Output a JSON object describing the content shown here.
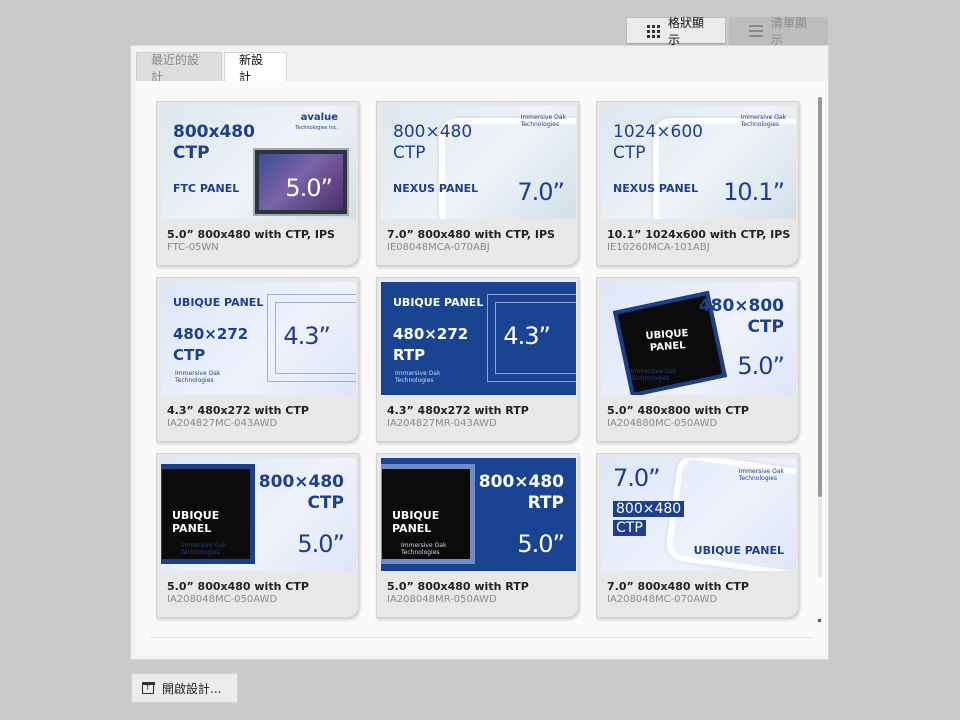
{
  "view_toggle": {
    "grid_label": "格狀顯示",
    "list_label": "清單顯示",
    "grid_icon": "grid-icon",
    "list_icon": "list-icon"
  },
  "tabs": [
    {
      "label": "最近的設計",
      "active": false
    },
    {
      "label": "新設計",
      "active": true
    }
  ],
  "cards": [
    {
      "title": "5.0” 800x480 with CTP, IPS",
      "code": "FTC-05WN",
      "thumb": {
        "res": "800x480\nCTP",
        "brand": "FTC PANEL",
        "size": "5.0”",
        "logo": "avalue",
        "logo_sub": "Technologies Inc."
      }
    },
    {
      "title": "7.0” 800x480 with CTP, IPS",
      "code": "IE08048MCA-070ABJ",
      "thumb": {
        "res": "800×480\nCTP",
        "brand": "NEXUS PANEL",
        "size": "7.0”",
        "logo": "Immersive Oak\nTechnologies"
      }
    },
    {
      "title": "10.1” 1024x600 with CTP, IPS",
      "code": "IE10260MCA-101ABJ",
      "thumb": {
        "res": "1024×600\nCTP",
        "brand": "NEXUS PANEL",
        "size": "10.1”",
        "logo": "Immersive Oak\nTechnologies"
      }
    },
    {
      "title": "4.3” 480x272 with CTP",
      "code": "IA204827MC-043AWD",
      "thumb": {
        "res": "480×272\nCTP",
        "brand": "UBIQUE PANEL",
        "size": "4.3”",
        "logo": "Immersive Oak\nTechnologies"
      }
    },
    {
      "title": "4.3” 480x272 with RTP",
      "code": "IA204827MR-043AWD",
      "thumb": {
        "res": "480×272\nRTP",
        "brand": "UBIQUE PANEL",
        "size": "4.3”",
        "logo": "Immersive Oak\nTechnologies"
      }
    },
    {
      "title": "5.0” 480x800 with CTP",
      "code": "IA204880MC-050AWD",
      "thumb": {
        "res": "480×800\nCTP",
        "brand": "UBIQUE\nPANEL",
        "size": "5.0”",
        "logo": "Immersive Oak\nTechnologies"
      }
    },
    {
      "title": "5.0” 800x480 with CTP",
      "code": "IA208048MC-050AWD",
      "thumb": {
        "res": "800×480\nCTP",
        "brand": "UBIQUE PANEL",
        "size": "5.0”",
        "logo": "Immersive Oak\nTechnologies"
      }
    },
    {
      "title": "5.0” 800x480 with RTP",
      "code": "IA208048MR-050AWD",
      "thumb": {
        "res": "800×480\nRTP",
        "brand": "UBIQUE PANEL",
        "size": "5.0”",
        "logo": "Immersive Oak\nTechnologies"
      }
    },
    {
      "title": "7.0” 800x480 with CTP",
      "code": "IA208048MC-070AWD",
      "thumb": {
        "res1": "800×480",
        "res2": "CTP",
        "brand": "UBIQUE PANEL",
        "size": "7.0”",
        "logo": "Immersive Oak\nTechnologies"
      }
    }
  ],
  "open_button": {
    "label": "開啟設計...",
    "icon": "open-file-icon"
  }
}
